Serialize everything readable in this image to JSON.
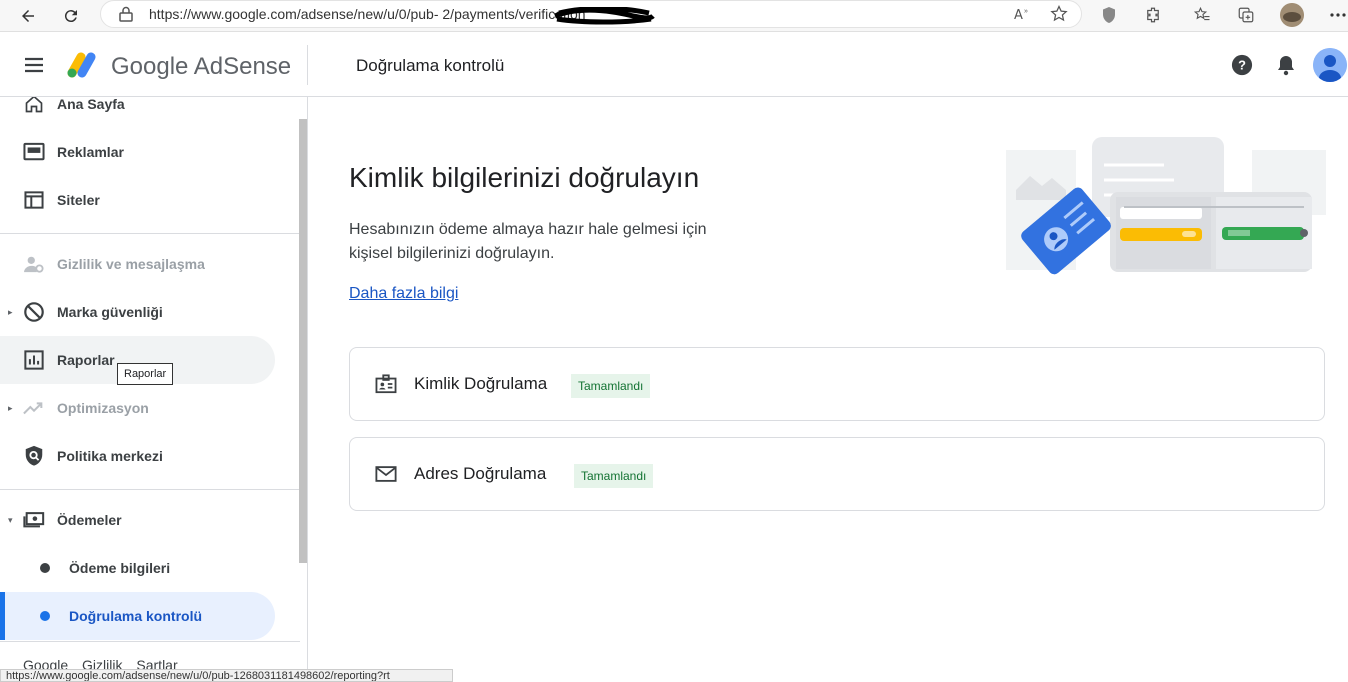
{
  "browser": {
    "url": "https://www.google.com/adsense/new/u/0/pub-                      2/payments/verification",
    "status_url": "https://www.google.com/adsense/new/u/0/pub-1268031181498602/reporting?rt"
  },
  "header": {
    "brand": "Google AdSense",
    "page_title": "Doğrulama kontrolü"
  },
  "sidebar": {
    "items": [
      {
        "label": "Ana Sayfa",
        "icon": "home-icon"
      },
      {
        "label": "Reklamlar",
        "icon": "ads-icon"
      },
      {
        "label": "Siteler",
        "icon": "sites-icon"
      },
      {
        "label": "Gizlilik ve mesajlaşma",
        "icon": "privacy-icon"
      },
      {
        "label": "Marka güvenliği",
        "icon": "block-icon"
      },
      {
        "label": "Raporlar",
        "icon": "reports-icon"
      },
      {
        "label": "Optimizasyon",
        "icon": "trending-icon"
      },
      {
        "label": "Politika merkezi",
        "icon": "policy-shield-icon"
      },
      {
        "label": "Ödemeler",
        "icon": "payments-icon"
      },
      {
        "label": "Ödeme bilgileri"
      },
      {
        "label": "Doğrulama kontrolü"
      }
    ],
    "tooltip": "Raporlar",
    "footer": [
      "Google",
      "Gizlilik",
      "Şartlar"
    ]
  },
  "main": {
    "heading": "Kimlik bilgilerinizi doğrulayın",
    "description": "Hesabınızın ödeme almaya hazır hale gelmesi için kişisel bilgilerinizi doğrulayın.",
    "learn_more": "Daha fazla bilgi",
    "cards": [
      {
        "title": "Kimlik Doğrulama",
        "status": "Tamamlandı",
        "icon": "id-card-icon"
      },
      {
        "title": "Adres Doğrulama",
        "status": "Tamamlandı",
        "icon": "mail-icon"
      }
    ]
  },
  "colors": {
    "accent": "#1a73e8",
    "badge_bg": "#e6f4ea",
    "badge_text": "#137333"
  }
}
